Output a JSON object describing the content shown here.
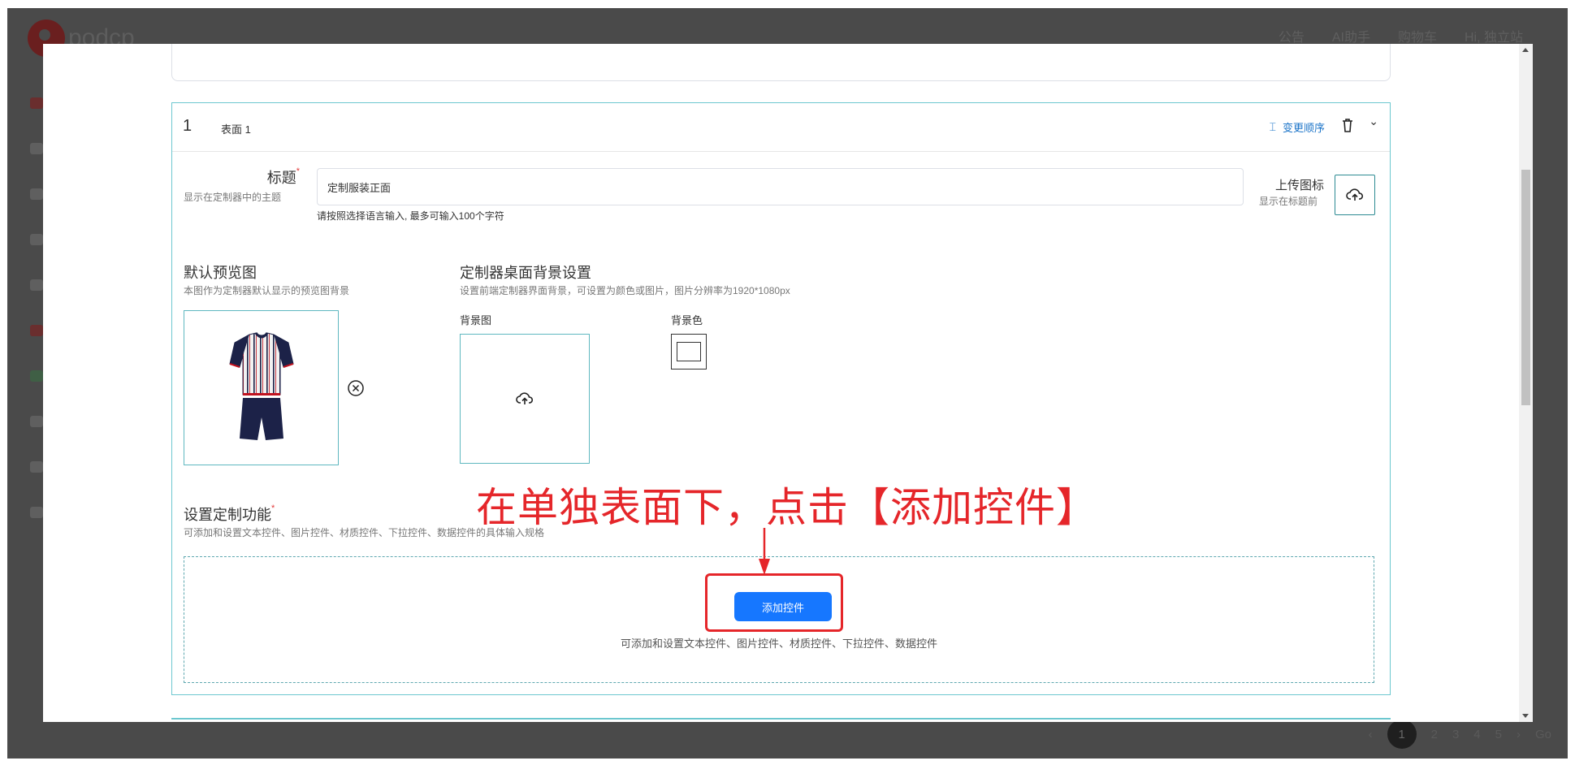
{
  "background_app": {
    "logo_text": "podcp",
    "nav": [
      "公告",
      "AI助手",
      "购物车",
      "Hi, 独立站"
    ],
    "pagination": {
      "pages": [
        "1",
        "2",
        "3",
        "4",
        "5"
      ],
      "current": "1",
      "go_label": "Go"
    }
  },
  "surface": {
    "index": "1",
    "name": "表面 1",
    "reorder_label": "变更顺序",
    "title_field": {
      "label": "标题",
      "required_mark": "*",
      "hint": "显示在定制器中的主题",
      "value": "定制服装正面",
      "help": "请按照选择语言输入, 最多可输入100个字符"
    },
    "upload_icon": {
      "label": "上传图标",
      "hint": "显示在标题前"
    },
    "default_preview": {
      "title": "默认预览图",
      "hint": "本图作为定制器默认显示的预览图背景"
    },
    "background_settings": {
      "title": "定制器桌面背景设置",
      "hint": "设置前端定制器界面背景，可设置为颜色或图片，图片分辨率为1920*1080px",
      "image_label": "背景图",
      "color_label": "背景色",
      "color_value": "#ffffff"
    },
    "customize_functions": {
      "title": "设置定制功能",
      "required_mark": "*",
      "hint": "可添加和设置文本控件、图片控件、材质控件、下拉控件、数据控件的具体输入规格",
      "add_button": "添加控件",
      "note": "可添加和设置文本控件、图片控件、材质控件、下拉控件、数据控件"
    }
  },
  "annotation": {
    "text": "在单独表面下，点击【添加控件】",
    "color": "#e5262a"
  },
  "colors": {
    "accent": "#1677ff",
    "border_teal": "#6cc7cf",
    "link": "#1a73c8"
  }
}
